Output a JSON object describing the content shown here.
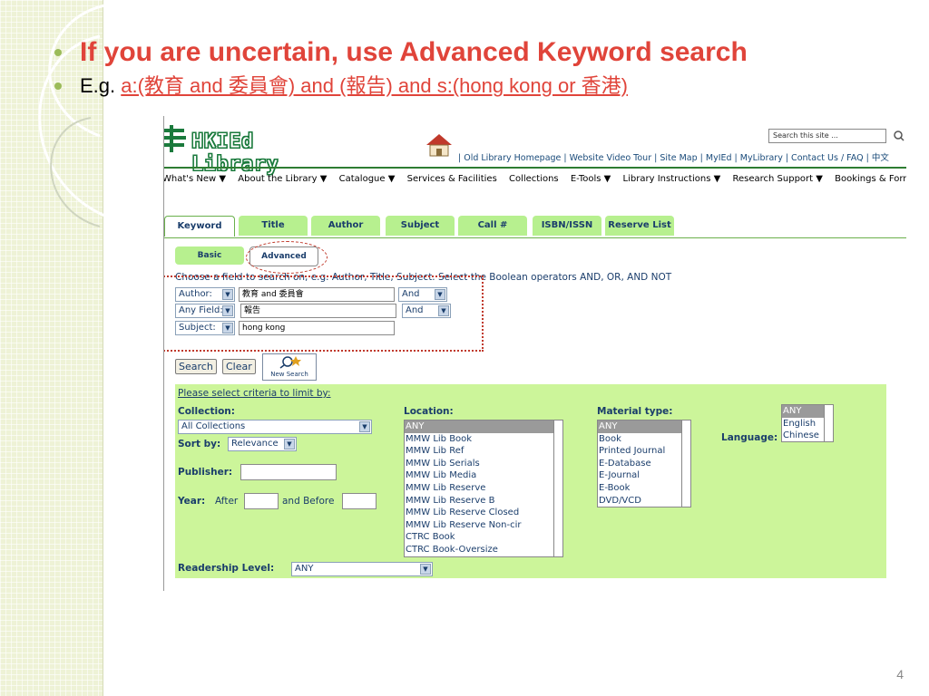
{
  "slide": {
    "bullet1": "If you are uncertain, use Advanced Keyword search",
    "bullet2_prefix": "E.g. ",
    "bullet2_link": "a:(教育 and 委員會) and (報告) and s:(hong kong or 香港)",
    "page_number": "4"
  },
  "library": {
    "logo_text": "HKIEd Library",
    "toplinks": "| Old Library Homepage | Website Video Tour | Site Map | MyIEd | MyLibrary | Contact Us / FAQ | 中文",
    "site_search_placeholder": "Search this site ...",
    "nav": [
      "What's New ▼",
      "About the Library ▼",
      "Catalogue ▼",
      "Services & Facilities",
      "Collections",
      "E-Tools ▼",
      "Library Instructions ▼",
      "Research Support ▼",
      "Bookings & Forms ▼"
    ],
    "tabs": [
      "Keyword",
      "Title",
      "Author",
      "Subject",
      "Call #",
      "ISBN/ISSN",
      "Reserve List"
    ],
    "subtabs": {
      "basic": "Basic",
      "advanced": "Advanced"
    },
    "instruction": "Choose a field to search on, e.g. Author, Title, Subject. Select the Boolean operators AND, OR, AND NOT",
    "rows": [
      {
        "field": "Author:",
        "value": "教育 and 委員會",
        "op": "And"
      },
      {
        "field": "Any Field:",
        "value": "報告",
        "op": "And"
      },
      {
        "field": "Subject:",
        "value": "hong kong",
        "op": ""
      }
    ],
    "buttons": {
      "search": "Search",
      "clear": "Clear",
      "new_search": "New Search"
    },
    "limits": {
      "heading": "Please select criteria to limit by:",
      "collection_label": "Collection:",
      "collection_value": "All Collections",
      "sortby_label": "Sort by:",
      "sortby_value": "Relevance",
      "publisher_label": "Publisher:",
      "year_label": "Year:",
      "after_label": "After",
      "before_label": "and Before",
      "readership_label": "Readership Level:",
      "readership_value": "ANY",
      "location_label": "Location:",
      "locations": [
        "ANY",
        "MMW Lib Book",
        "MMW Lib Ref",
        "MMW Lib Serials",
        "MMW Lib Media",
        "MMW Lib Reserve",
        "MMW Lib Reserve B",
        "MMW Lib Reserve Closed",
        "MMW Lib Reserve Non-cir",
        "CTRC Book",
        "CTRC Book-Oversize"
      ],
      "material_label": "Material type:",
      "materials": [
        "ANY",
        "Book",
        "Printed Journal",
        "E-Database",
        "E-Journal",
        "E-Book",
        "DVD/VCD"
      ],
      "language_label": "Language:",
      "languages": [
        "ANY",
        "English",
        "Chinese"
      ]
    }
  },
  "colors": {
    "accent_red": "#e0443a",
    "tab_green": "#b7f08f",
    "panel_green": "#ccf59a",
    "bullet_green": "#9bbb59"
  }
}
